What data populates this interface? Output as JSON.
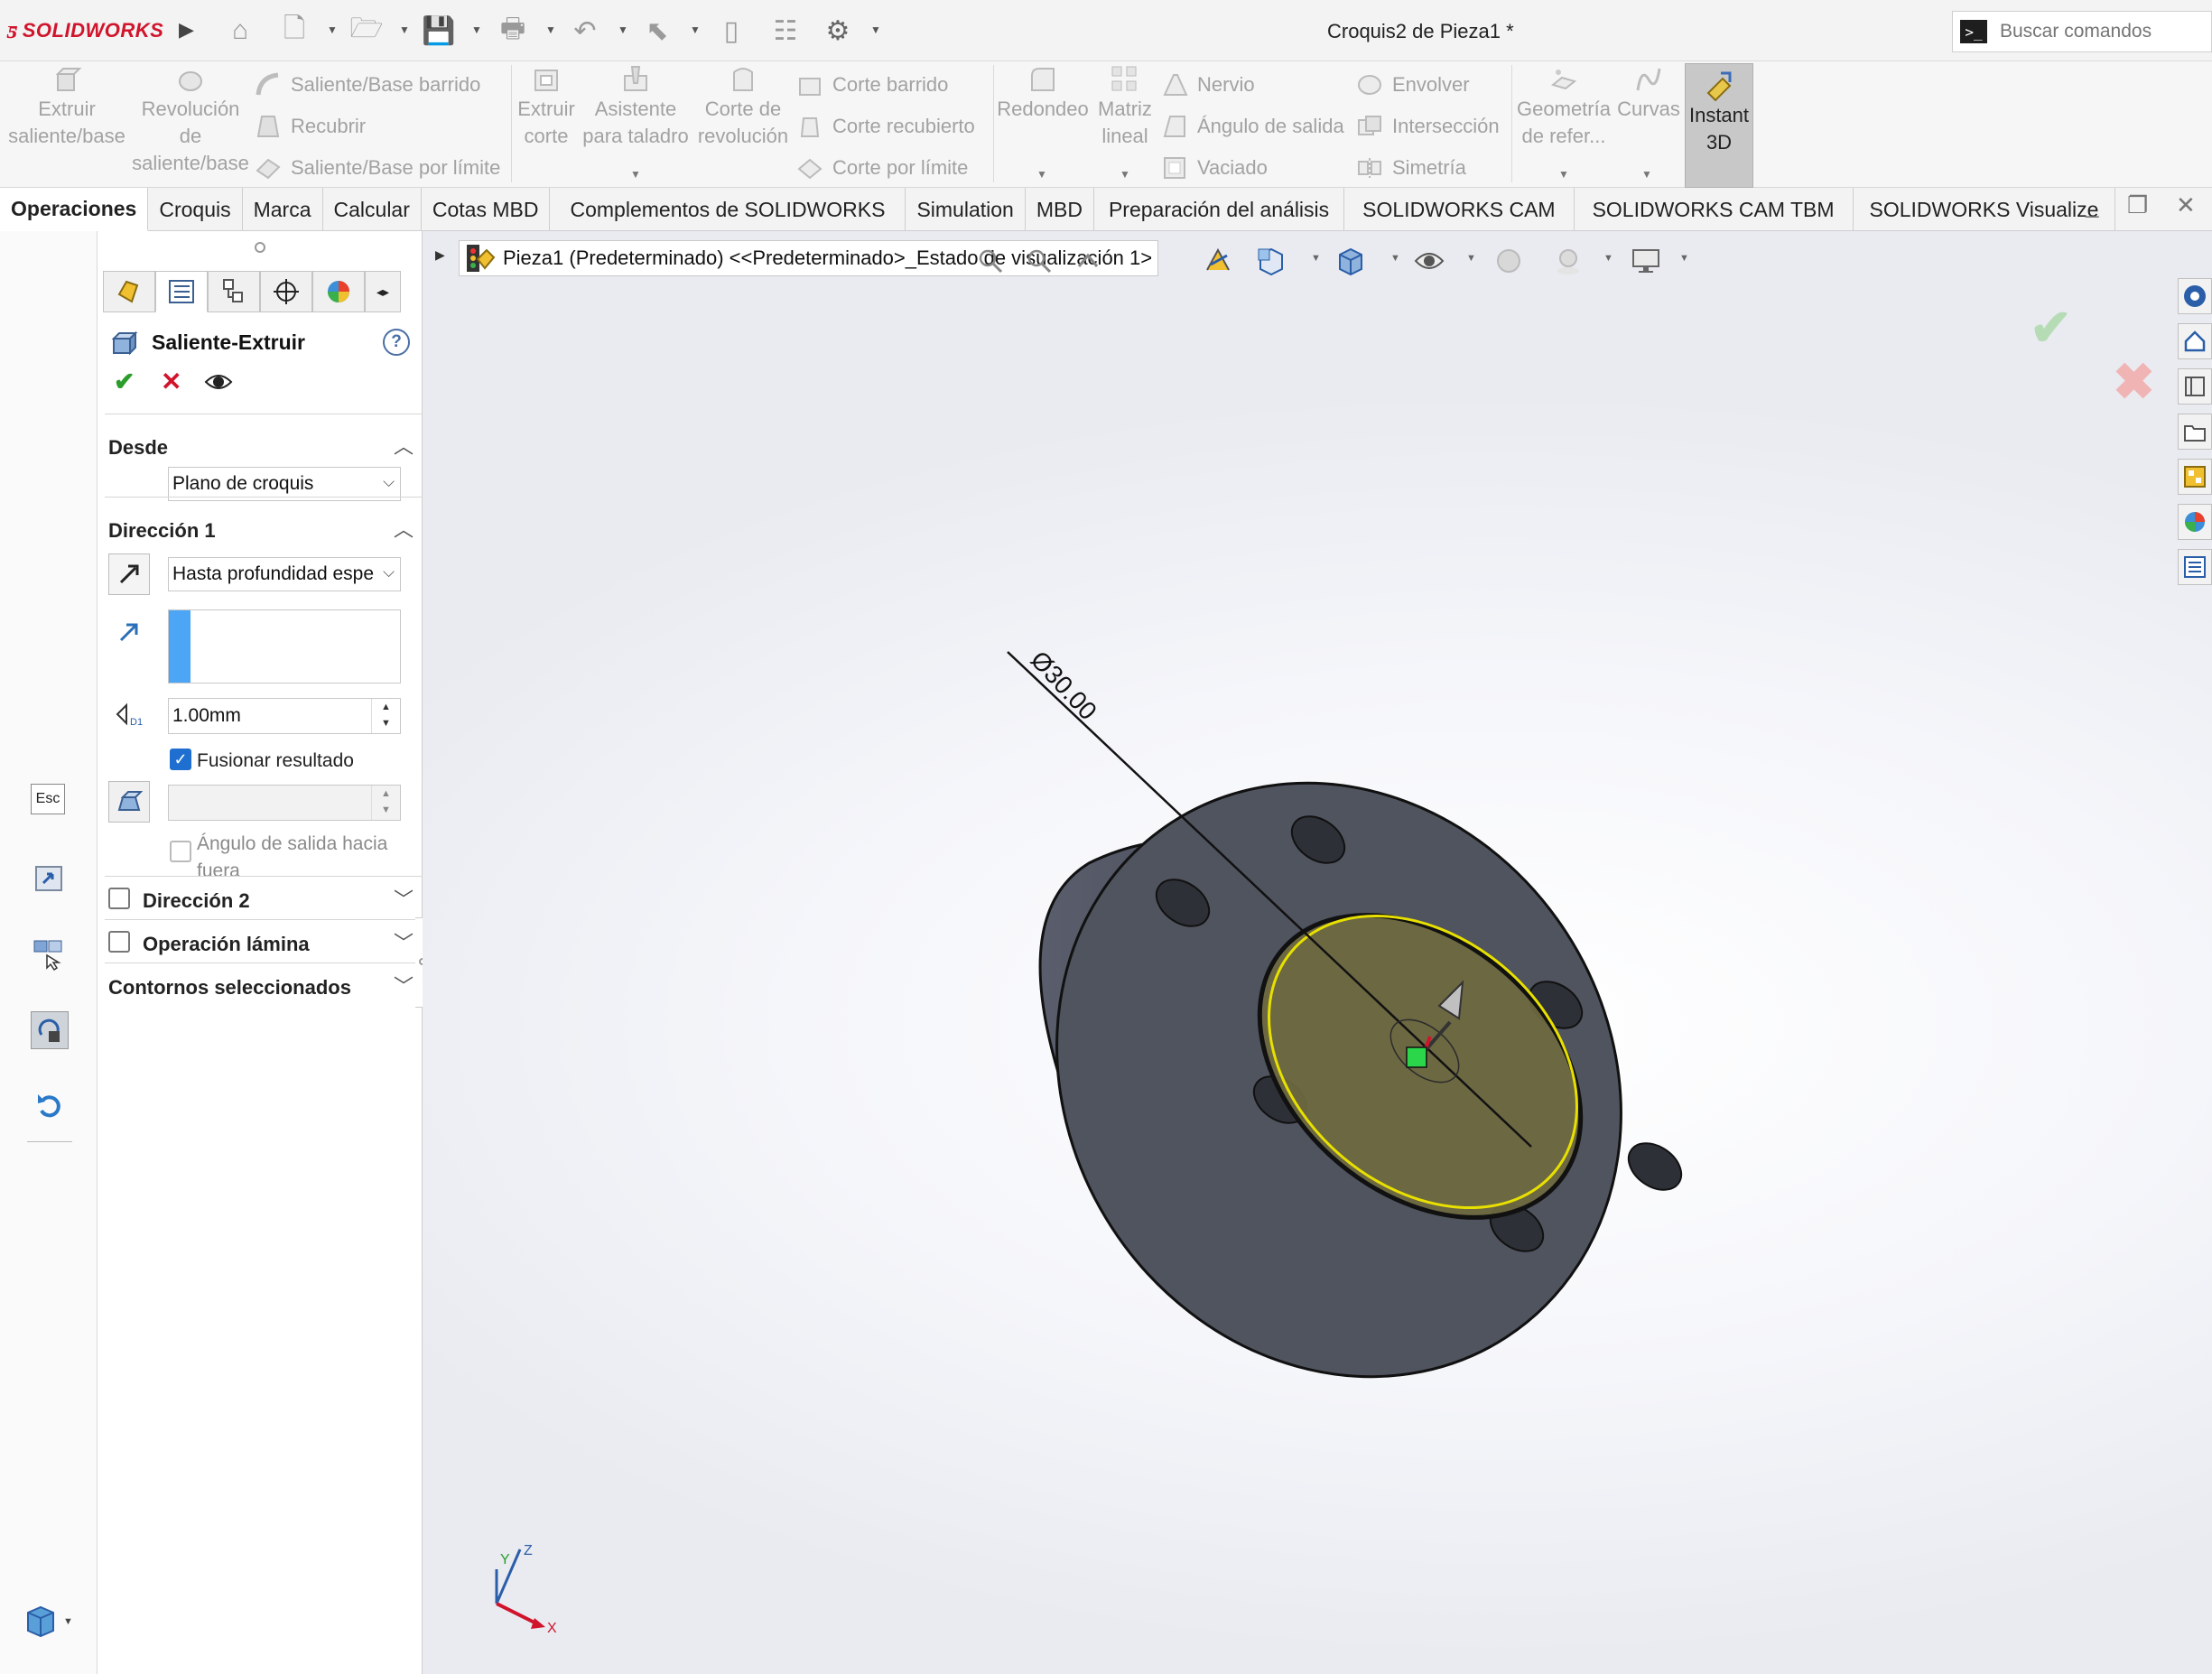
{
  "app": {
    "logo_text": "SOLIDWORKS",
    "document_title": "Croquis2 de Pieza1 *",
    "search_placeholder": "Buscar comandos"
  },
  "ribbon": {
    "extruir_saliente": [
      "Extruir",
      "saliente/base"
    ],
    "revolucion": [
      "Revolución",
      "de",
      "saliente/base"
    ],
    "saliente_barrido": "Saliente/Base barrido",
    "recubrir": "Recubrir",
    "saliente_limite": "Saliente/Base por límite",
    "extruir_corte": [
      "Extruir",
      "corte"
    ],
    "asistente_taladro": [
      "Asistente",
      "para taladro"
    ],
    "corte_revolucion": [
      "Corte de",
      "revolución"
    ],
    "corte_barrido": "Corte barrido",
    "corte_recubierto": "Corte recubierto",
    "corte_limite": "Corte por límite",
    "redondeo": "Redondeo",
    "matriz_lineal": [
      "Matriz",
      "lineal"
    ],
    "nervio": "Nervio",
    "angulo_salida": "Ángulo de salida",
    "vaciado": "Vaciado",
    "envolver": "Envolver",
    "interseccion": "Intersección",
    "simetria": "Simetría",
    "geometria_ref": [
      "Geometría",
      "de refer..."
    ],
    "curvas": "Curvas",
    "instant3d": [
      "Instant",
      "3D"
    ]
  },
  "tabs": [
    {
      "label": "Operaciones",
      "active": true
    },
    {
      "label": "Croquis"
    },
    {
      "label": "Marca"
    },
    {
      "label": "Calcular"
    },
    {
      "label": "Cotas MBD"
    },
    {
      "label": "Complementos de SOLIDWORKS"
    },
    {
      "label": "Simulation"
    },
    {
      "label": "MBD"
    },
    {
      "label": "Preparación del análisis"
    },
    {
      "label": "SOLIDWORKS CAM"
    },
    {
      "label": "SOLIDWORKS CAM TBM"
    },
    {
      "label": "SOLIDWORKS Visualize"
    }
  ],
  "left_strip": {
    "esc_label": "Esc"
  },
  "property_manager": {
    "title": "Saliente-Extruir",
    "desde": {
      "title": "Desde",
      "value": "Plano de croquis"
    },
    "direccion1": {
      "title": "Dirección 1",
      "end_condition": "Hasta profundidad espe",
      "depth": "1.00mm",
      "merge_label": "Fusionar resultado",
      "merge_checked": true,
      "draft_label_line1": "Ángulo de salida hacia",
      "draft_label_line2": "fuera"
    },
    "direccion2": {
      "title": "Dirección 2"
    },
    "operacion_lamina": {
      "title": "Operación lámina"
    },
    "contornos": {
      "title": "Contornos seleccionados"
    }
  },
  "viewport": {
    "breadcrumb": "Pieza1 (Predeterminado) <<Predeterminado>_Estado de visualización 1>",
    "dimension": "Ø30.00",
    "triad": {
      "x": "X",
      "y": "Y",
      "z": "Z"
    }
  },
  "colors": {
    "accent_red": "#d0142c",
    "part_face": "#4a4e5a",
    "sketch_fill": "#6f6a40",
    "sketch_outline": "#e8e000",
    "ok_green": "#2a9d2a"
  }
}
